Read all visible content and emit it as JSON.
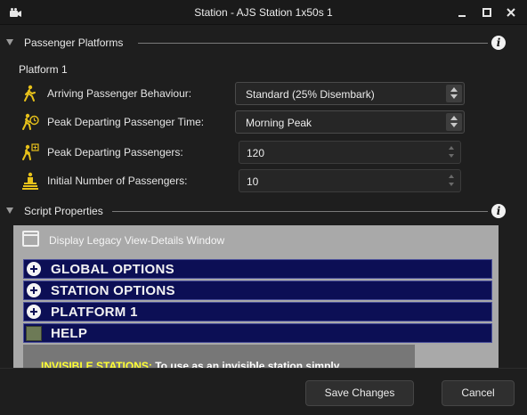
{
  "window": {
    "title": "Station - AJS Station 1x50s 1",
    "app_icon": "camera-icon",
    "controls": [
      "minimize-icon",
      "maximize-icon",
      "close-icon"
    ]
  },
  "passenger_platforms": {
    "header": "Passenger Platforms",
    "info_icon": "i",
    "platform_label": "Platform 1",
    "properties": {
      "arriving_behaviour": {
        "label": "Arriving Passenger Behaviour:",
        "value": "Standard (25% Disembark)",
        "icon": "walking-passenger-icon"
      },
      "peak_departing_time": {
        "label": "Peak Departing Passenger Time:",
        "value": "Morning Peak",
        "icon": "passenger-clock-icon"
      },
      "peak_departing_passengers": {
        "label": "Peak Departing Passengers:",
        "value": "120",
        "icon": "passenger-count-icon"
      },
      "initial_passengers": {
        "label": "Initial Number of Passengers:",
        "value": "10",
        "icon": "waiting-passengers-icon"
      }
    }
  },
  "script_properties": {
    "header": "Script Properties",
    "info_icon": "i",
    "legacy_label": "Display Legacy View-Details Window",
    "options": {
      "global": "GLOBAL OPTIONS",
      "station": "STATION OPTIONS",
      "platform": "PLATFORM 1",
      "help": "HELP"
    },
    "help_text": {
      "keyword": "INVISIBLE STATIONS:",
      "body": " To use as an invisible station simply"
    }
  },
  "footer": {
    "save_label": "Save Changes",
    "cancel_label": "Cancel"
  },
  "colors": {
    "background": "#1e1e1e",
    "option_bar": "#0c0f55",
    "script_panel": "#a9a9a9",
    "help_keyword": "#ffff33",
    "passenger_icon": "#e8c21a"
  }
}
